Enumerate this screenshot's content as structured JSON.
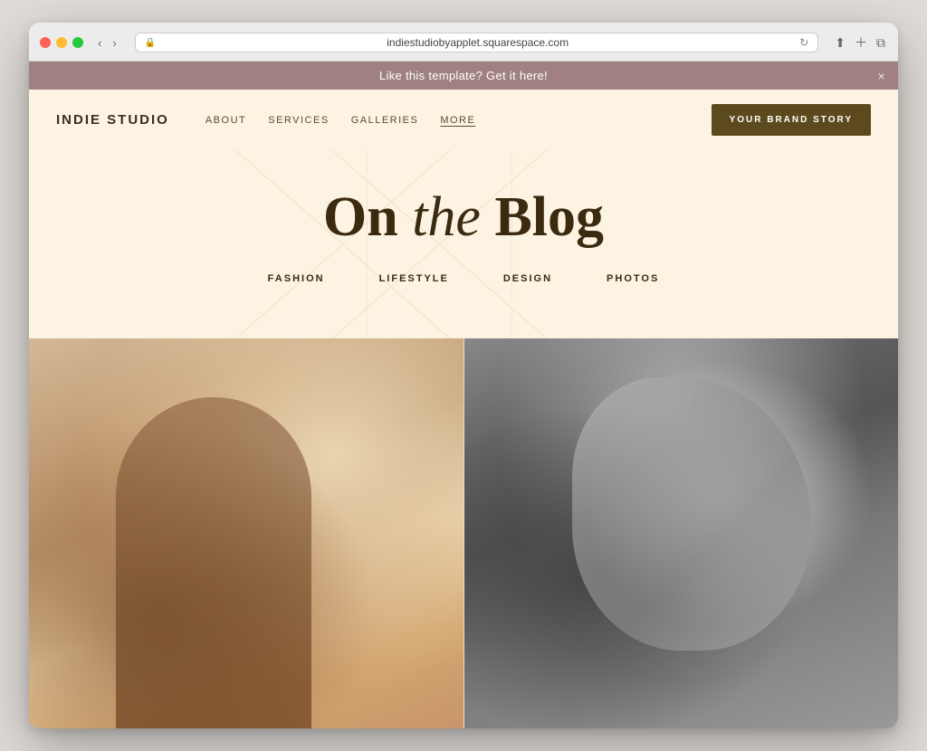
{
  "browser": {
    "url": "indiestudiobyapplet.squarespace.com",
    "controls": {
      "back": "‹",
      "forward": "›"
    }
  },
  "announcement": {
    "text": "Like this template? Get it here!",
    "close_label": "×"
  },
  "nav": {
    "logo": "INDIE STUDIO",
    "links": [
      {
        "label": "ABOUT",
        "active": false
      },
      {
        "label": "SERVICES",
        "active": false
      },
      {
        "label": "GALLERIES",
        "active": false
      },
      {
        "label": "MORE",
        "active": true
      }
    ],
    "cta": "YOUR BRAND STORY"
  },
  "hero": {
    "title_part1": "On ",
    "title_italic": "the",
    "title_part2": " Blog",
    "categories": [
      {
        "label": "FASHION"
      },
      {
        "label": "LIFESTYLE"
      },
      {
        "label": "DESIGN"
      },
      {
        "label": "PHOTOS"
      }
    ]
  }
}
